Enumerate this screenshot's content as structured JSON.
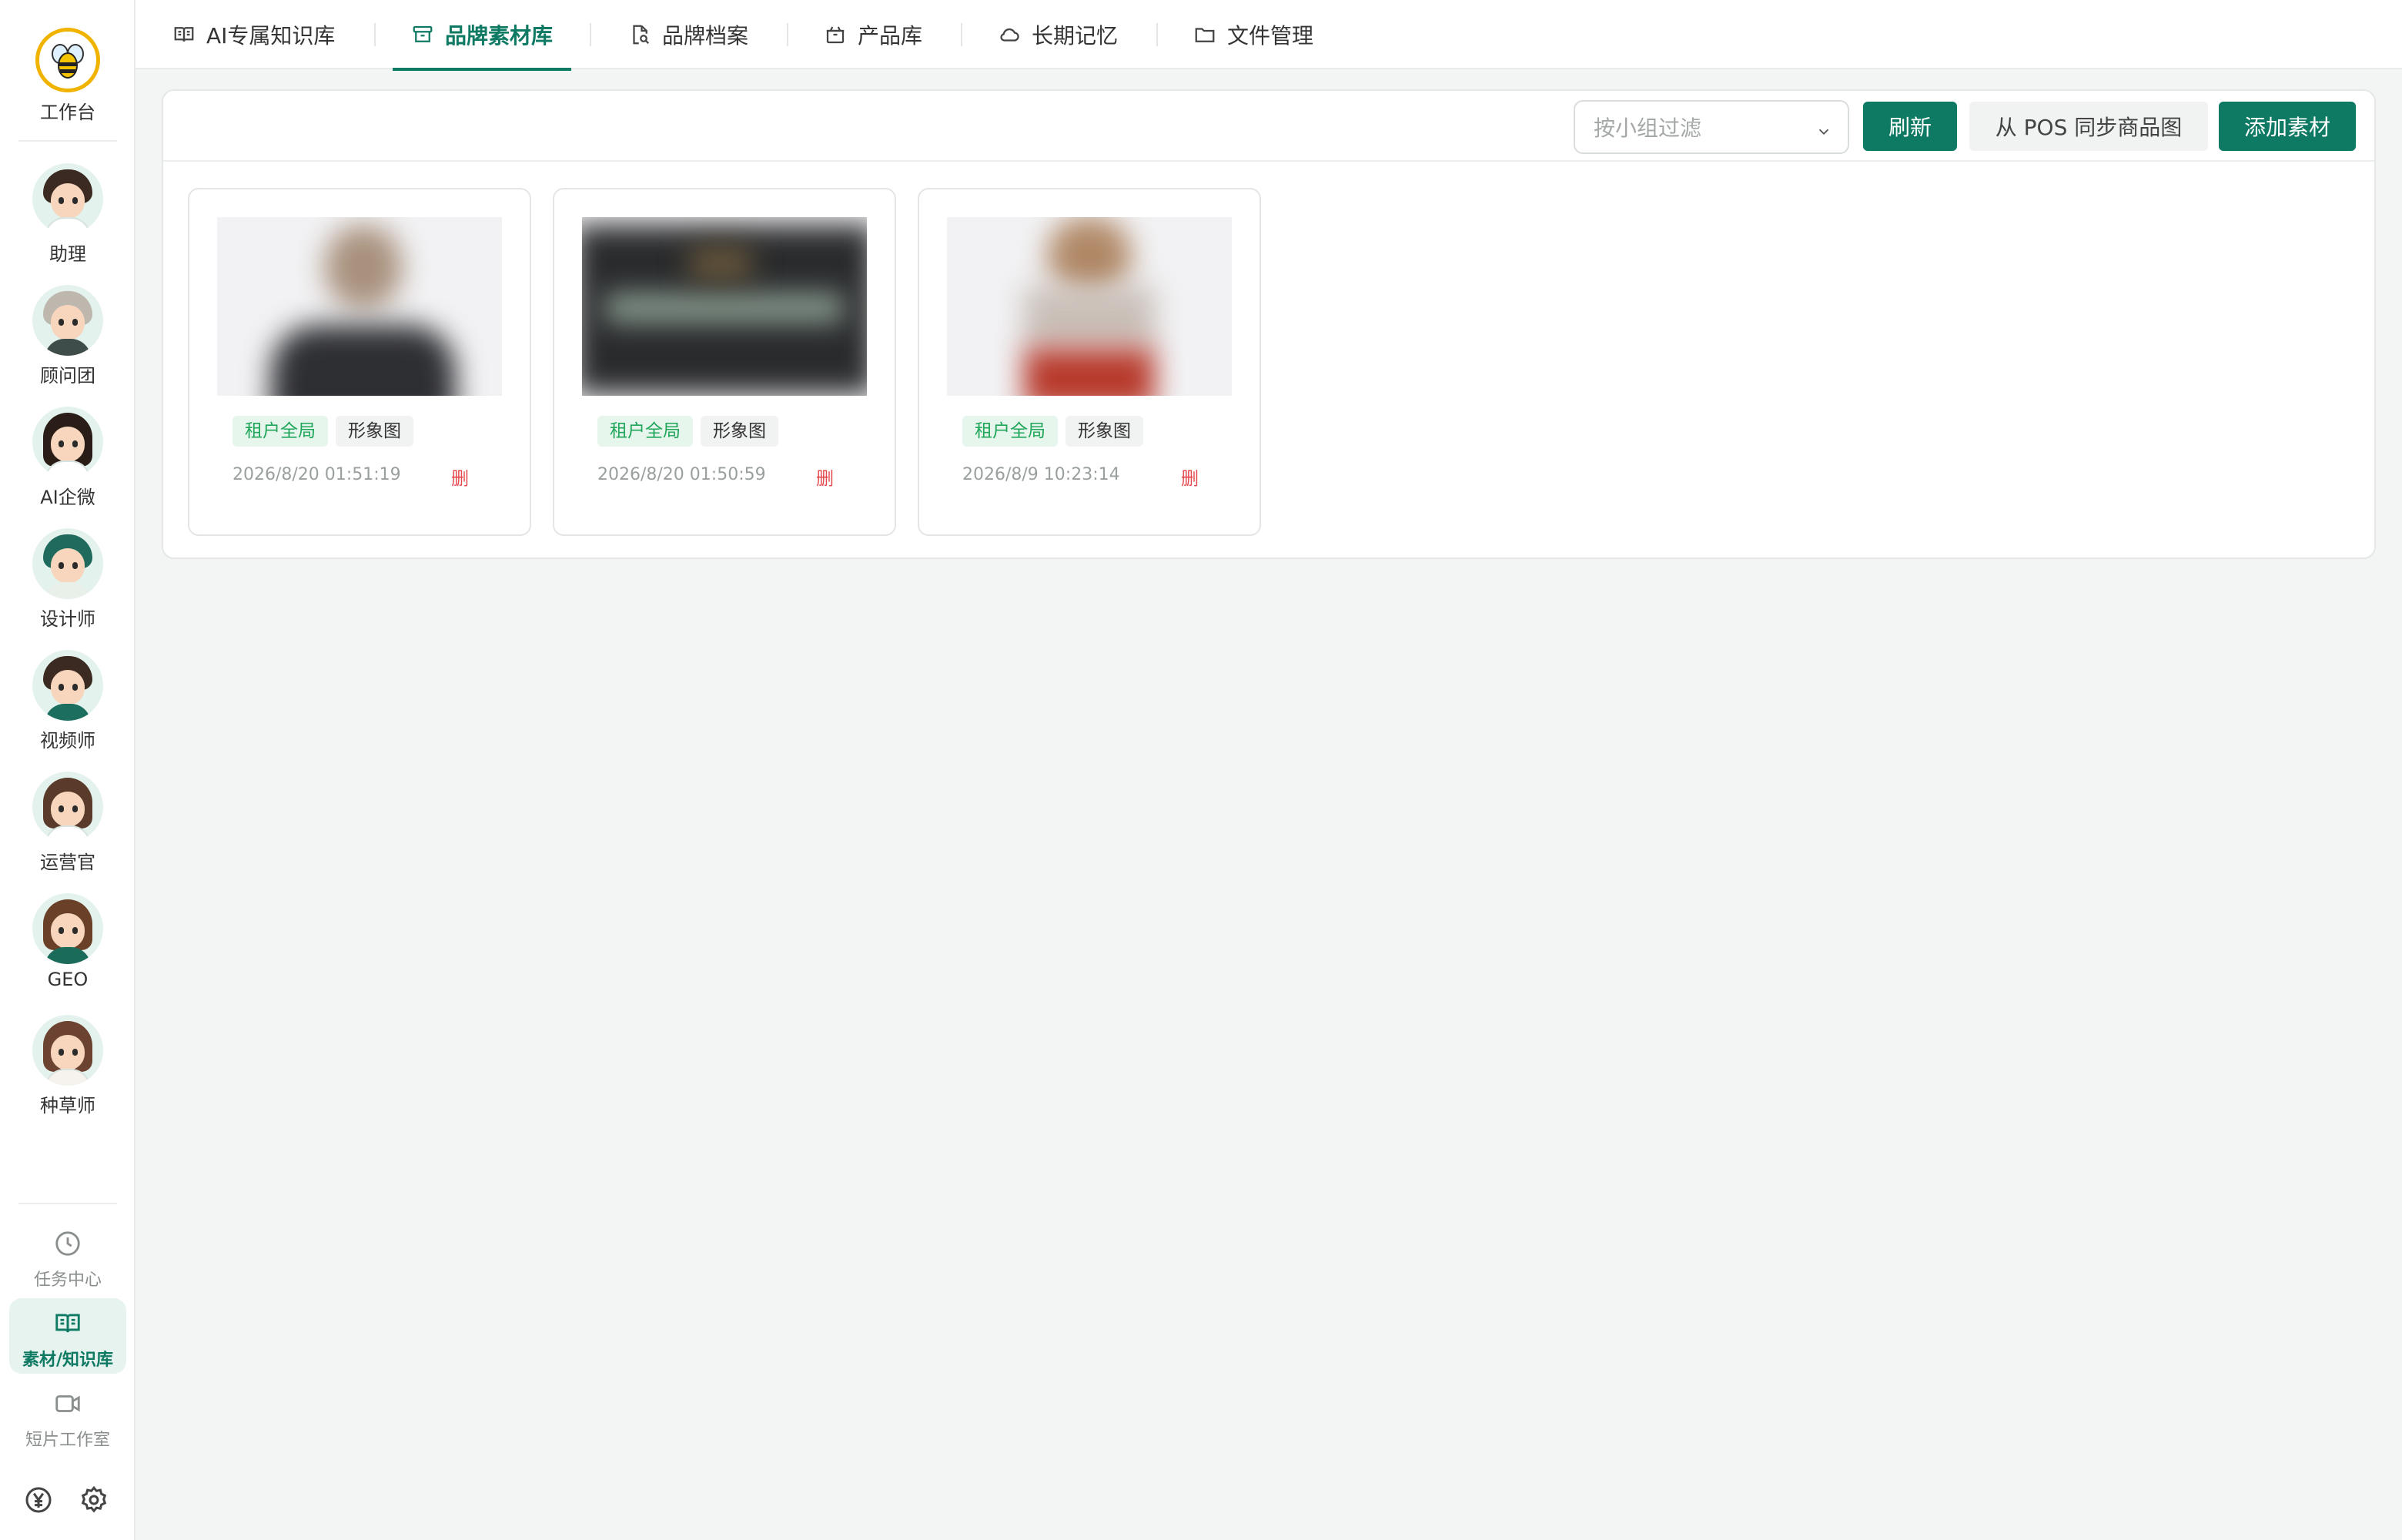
{
  "sidebar": {
    "logo_label": "工作台",
    "agents": [
      {
        "label": "助理",
        "hair": "#3a2a22",
        "body": "#ffffff"
      },
      {
        "label": "顾问团",
        "hair": "#bdb7ae",
        "body": "#3e4c4a"
      },
      {
        "label": "AI企微",
        "hair": "#2a1d18",
        "body": "#ffffff"
      },
      {
        "label": "设计师",
        "hair": "#1f6a5c",
        "body": "#e9efe9"
      },
      {
        "label": "视频师",
        "hair": "#3b2a22",
        "body": "#1c6e5f"
      },
      {
        "label": "运营官",
        "hair": "#5a3a2a",
        "body": "#ffffff"
      },
      {
        "label": "GEO",
        "hair": "#6a4128",
        "body": "#1a6b5a"
      },
      {
        "label": "种草师",
        "hair": "#6b4330",
        "body": "#f6f3ee"
      }
    ],
    "bottom_nav": [
      {
        "label": "任务中心",
        "icon": "clock-icon",
        "active": false
      },
      {
        "label": "素材/知识库",
        "icon": "book-icon",
        "active": true
      },
      {
        "label": "短片工作室",
        "icon": "video-icon",
        "active": false
      }
    ],
    "bottom_icons": [
      "yen-icon",
      "gear-icon"
    ]
  },
  "tabs": [
    {
      "label": "AI专属知识库",
      "icon": "book-open-icon",
      "active": false
    },
    {
      "label": "品牌素材库",
      "icon": "archive-icon",
      "active": true
    },
    {
      "label": "品牌档案",
      "icon": "file-search-icon",
      "active": false
    },
    {
      "label": "产品库",
      "icon": "package-icon",
      "active": false
    },
    {
      "label": "长期记忆",
      "icon": "cloud-icon",
      "active": false
    },
    {
      "label": "文件管理",
      "icon": "folder-icon",
      "active": false
    }
  ],
  "toolbar": {
    "filter_placeholder": "按小组过滤",
    "refresh_label": "刷新",
    "sync_label": "从 POS 同步商品图",
    "add_label": "添加素材"
  },
  "assets": [
    {
      "scope_tag": "租户全局",
      "type_tag": "形象图",
      "date": "2026/8/20 01:51:19",
      "delete_label": "删"
    },
    {
      "scope_tag": "租户全局",
      "type_tag": "形象图",
      "date": "2026/8/20 01:50:59",
      "delete_label": "删"
    },
    {
      "scope_tag": "租户全局",
      "type_tag": "形象图",
      "date": "2026/8/9 10:23:14",
      "delete_label": "删"
    }
  ],
  "colors": {
    "accent": "#0f7a63",
    "tag_green": "#1fa65a",
    "danger": "#e5484d"
  }
}
